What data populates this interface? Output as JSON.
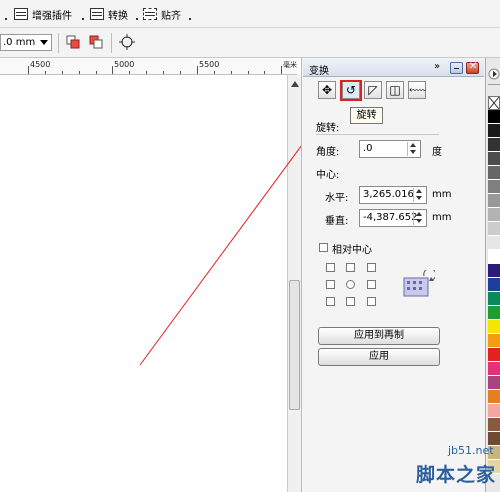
{
  "toolbar": {
    "items": [
      {
        "label": "增强插件"
      },
      {
        "label": "转换"
      },
      {
        "label": "贴齐"
      }
    ],
    "unit_value": ".0 mm"
  },
  "ruler": {
    "ticks": [
      "4500",
      "5000",
      "5500"
    ],
    "unit": "毫米"
  },
  "docker": {
    "title": "变换",
    "tooltip": "旋转",
    "section_label": "旋转:",
    "angle_label": "角度:",
    "angle_value": ".0",
    "angle_unit": "度",
    "center_label": "中心:",
    "h_label": "水平:",
    "h_value": "3,265.016",
    "h_unit": "mm",
    "v_label": "垂直:",
    "v_value": "-4,387.652",
    "v_unit": "mm",
    "relative_center_label": "相对中心",
    "relative_center_checked": false,
    "apply_copy_label": "应用到再制",
    "apply_label": "应用"
  },
  "palette": {
    "colors": [
      "#ffffff",
      "#000000",
      "#1a1a1a",
      "#333333",
      "#4d4d4d",
      "#666666",
      "#808080",
      "#999999",
      "#b3b3b3",
      "#cccccc",
      "#e6e6e6",
      "#ffffff",
      "#2e1a78",
      "#1c3f9c",
      "#0a8a5a",
      "#1f9e2f",
      "#f5e600",
      "#f39c12",
      "#e2231a",
      "#e5317a",
      "#a8457f",
      "#e67e22",
      "#f4a6a0",
      "#8a5a3c",
      "#6e4b32",
      "#c9b47a",
      "#e4d3a5"
    ]
  },
  "watermark": {
    "site": "jb51.net",
    "name": "脚本之家"
  }
}
